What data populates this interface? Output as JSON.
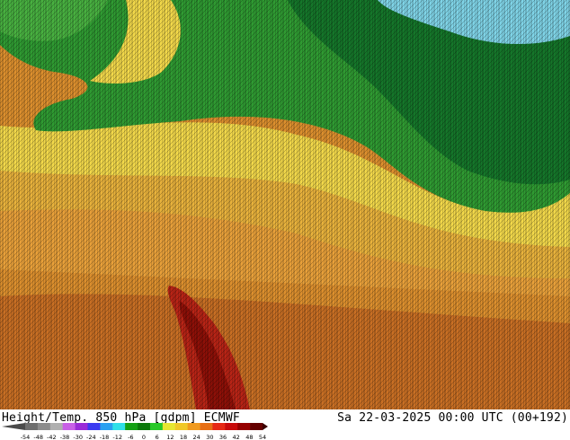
{
  "map": {
    "product": "Height/Temp. 850 hPa [gdpm] ECMWF",
    "valid_time": "Sa 22-03-2025 00:00 UTC (00+192)",
    "colors": {
      "deep_green": "#0e6e1a",
      "green": "#1f8f2a",
      "light_green": "#3aa63a",
      "yellow": "#f2d84a",
      "gold": "#e8b23c",
      "orange": "#dc8f2e",
      "dark_orange": "#c86f24",
      "red": "#c8301c",
      "dark_red": "#9a140c",
      "cyan": "#7fd3e6"
    }
  },
  "legend": {
    "ticks": [
      "-54",
      "-48",
      "-42",
      "-38",
      "-30",
      "-24",
      "-18",
      "-12",
      "-6",
      "0",
      "6",
      "12",
      "18",
      "24",
      "30",
      "36",
      "42",
      "48",
      "54"
    ],
    "colors": [
      "#6e6e6e",
      "#8c8c8c",
      "#b0b0b0",
      "#c860e6",
      "#9a2cd8",
      "#3c3cf0",
      "#2aa0f0",
      "#30e0e8",
      "#14a014",
      "#0a780a",
      "#28c828",
      "#e6e632",
      "#f0c828",
      "#f09a1e",
      "#e66e14",
      "#e62814",
      "#c80a0a",
      "#960000",
      "#640000"
    ]
  }
}
